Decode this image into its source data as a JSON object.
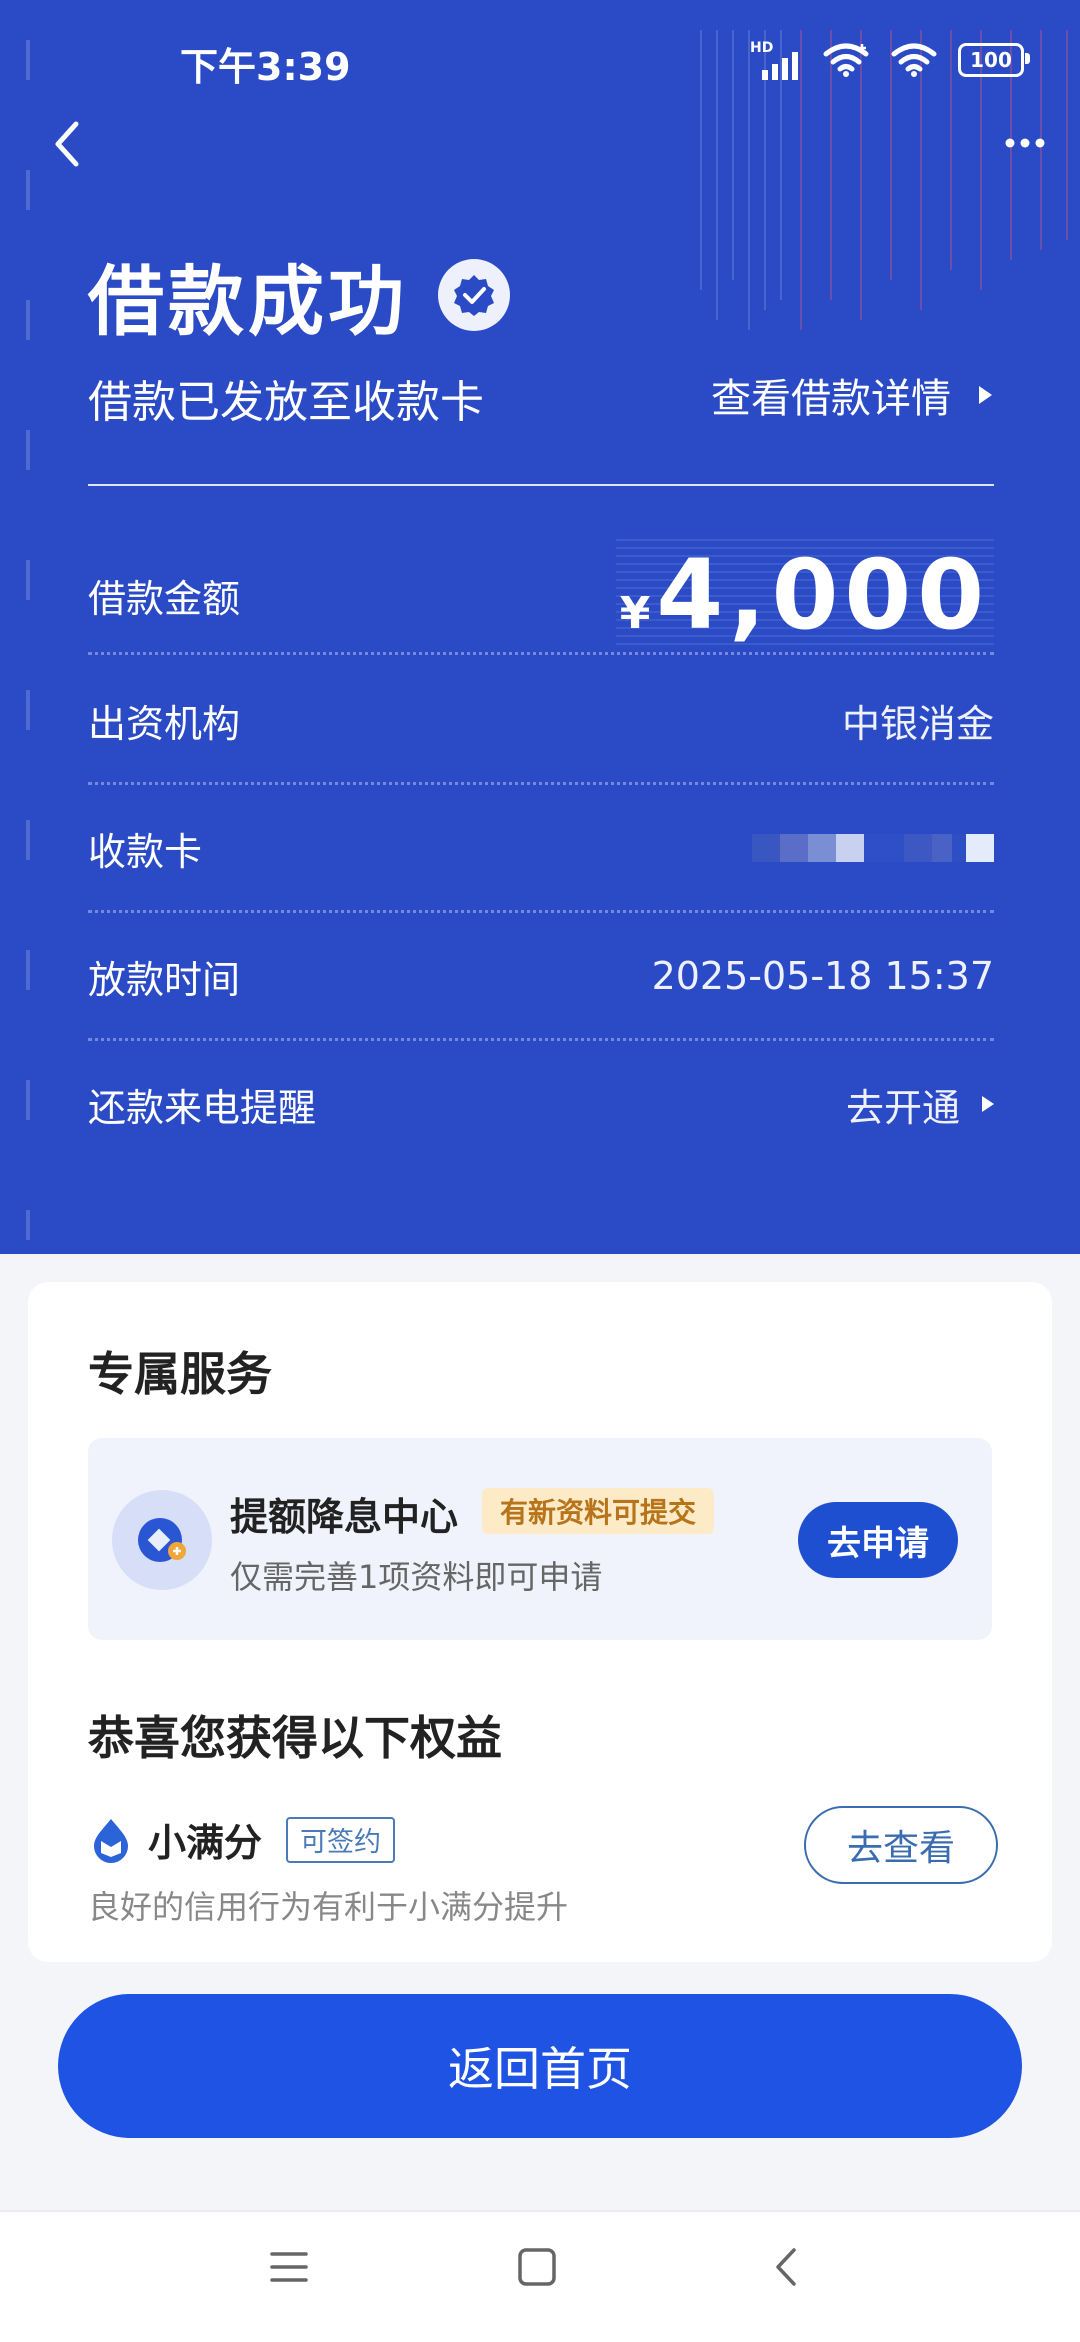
{
  "status_bar": {
    "time": "下午3:39",
    "hd": "HD",
    "battery": "100"
  },
  "result": {
    "title": "借款成功",
    "subtitle": "借款已发放至收款卡",
    "detail_link": "查看借款详情"
  },
  "info": {
    "amount": {
      "label": "借款金额",
      "currency": "¥",
      "value": "4,000"
    },
    "funder": {
      "label": "出资机构",
      "value": "中银消金"
    },
    "card": {
      "label": "收款卡"
    },
    "time": {
      "label": "放款时间",
      "value": "2025-05-18 15:37"
    },
    "reminder": {
      "label": "还款来电提醒",
      "link": "去开通"
    }
  },
  "services": {
    "title": "专属服务",
    "promo": {
      "name": "提额降息中心",
      "badge": "有新资料可提交",
      "desc": "仅需完善1项资料即可申请",
      "button": "去申请"
    }
  },
  "benefits": {
    "title": "恭喜您获得以下权益",
    "item": {
      "name": "小满分",
      "tag": "可签约",
      "desc": "良好的信用行为有利于小满分提升",
      "button": "去查看"
    }
  },
  "home_button": "返回首页",
  "colors": {
    "hero_bg": "#2a4bc5",
    "primary": "#1f53e3",
    "badge_bg": "#fdebc8",
    "badge_text": "#b8741a"
  }
}
